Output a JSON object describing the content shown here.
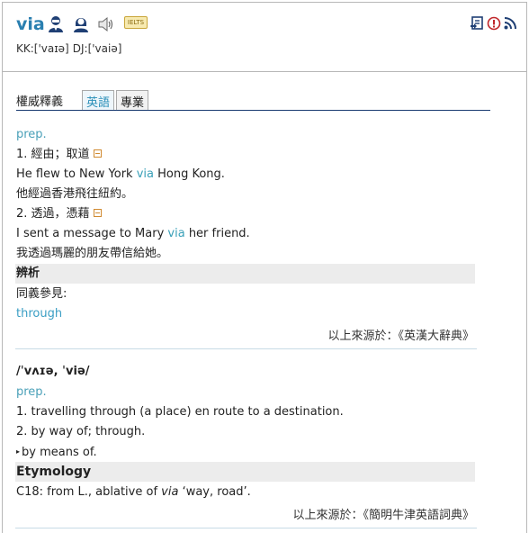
{
  "header": {
    "word": "via",
    "ielts_badge": "IELTS",
    "kk_label": "KK:['vaɪə]",
    "dj_label": "DJ:['vaiə]"
  },
  "tabs": {
    "section_title": "權威釋義",
    "items": [
      "英語",
      "專業"
    ]
  },
  "entry1": {
    "pos": "prep.",
    "sense1": "1. 經由；取道",
    "example1_before": "He flew to New York ",
    "example1_word": "via",
    "example1_after": " Hong Kong.",
    "example1_zh": "他經過香港飛往紐約。",
    "sense2": "2. 透過，憑藉",
    "example2_before": "I sent a message to Mary ",
    "example2_word": "via",
    "example2_after": " her friend.",
    "example2_zh": "我透過瑪麗的朋友帶信給她。",
    "analysis_heading": "辨析",
    "synonym_label": "同義參見:",
    "synonym_link": "through",
    "source": "以上來源於：《英漢大辭典》"
  },
  "entry2": {
    "ipa": "/ˈvʌɪə, ˈviə/",
    "pos": "prep.",
    "sense1": "1. travelling through (a place) en route to a destination.",
    "sense2": "2. by way of; through.",
    "sense3": "by means of.",
    "etymology_heading": "Etymology",
    "etymology_before": "C18: from L., ablative of ",
    "etymology_word": "via",
    "etymology_after": " ‘way, road’.",
    "source": "以上來源於：《簡明牛津英語詞典》"
  },
  "colors": {
    "accent": "#2a7fb0",
    "highlight": "#3aa0b8",
    "band": "#ececec"
  },
  "icons": [
    "male-voice-icon",
    "female-voice-icon",
    "speaker-icon",
    "wordbook-icon",
    "report-icon",
    "rss-icon"
  ]
}
